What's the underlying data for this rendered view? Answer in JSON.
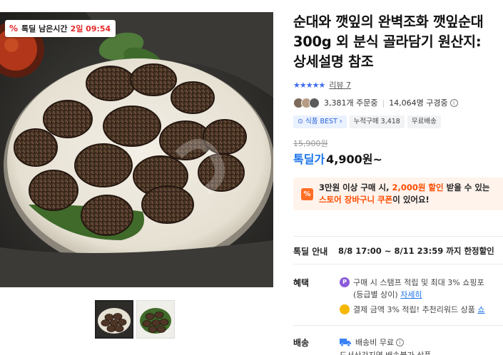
{
  "deal_badge": {
    "icon": "percent-icon",
    "label": "톡딜 남은시간",
    "time": "2일 09:54"
  },
  "title": "순대와 깻잎의 완벽조화 깻잎순대300g 외 분식 골라담기 원산지: 상세설명 참조",
  "rating": {
    "stars": "★★★★★",
    "review_label": "리뷰 7"
  },
  "stats": {
    "buyers": "3,381개 주문중",
    "subscribers": "14,064명 구경중"
  },
  "chips": [
    "식품 BEST",
    "누적구매 3,418",
    "무료배송"
  ],
  "price": {
    "original": "15,900원",
    "deal_label": "톡딜가",
    "current": "4,900원~"
  },
  "coupon": {
    "line1_prefix": "3만원 이상 구매 시,",
    "line1_highlight": "2,000원 할인",
    "line1_suffix": "받을 수 있는",
    "line2_highlight": "스토어 장바구니 쿠폰",
    "line2_suffix": "이 있어요!"
  },
  "deal_info": {
    "label": "톡딜 안내",
    "value": "8/8 17:00 ~ 8/11 23:59 까지 한정할인"
  },
  "benefits": {
    "label": "혜택",
    "item1": "구매 시 스탬프 적립 및 최대 3% 쇼핑포",
    "item1_sub": "(등급별 상이)",
    "item1_link": "자세히",
    "item2": "결제 금액 3% 적립! 추천리워드 상품",
    "item2_link": "쇼"
  },
  "shipping": {
    "label": "배송",
    "value": "배송비 무료",
    "sub": "도서산간지역 배송불가 상품"
  },
  "colors": {
    "deal_blue": "#1a72e8",
    "coupon_orange": "#ff4d00",
    "star_blue": "#3d6cf0",
    "badge_red": "#e52b2b"
  }
}
